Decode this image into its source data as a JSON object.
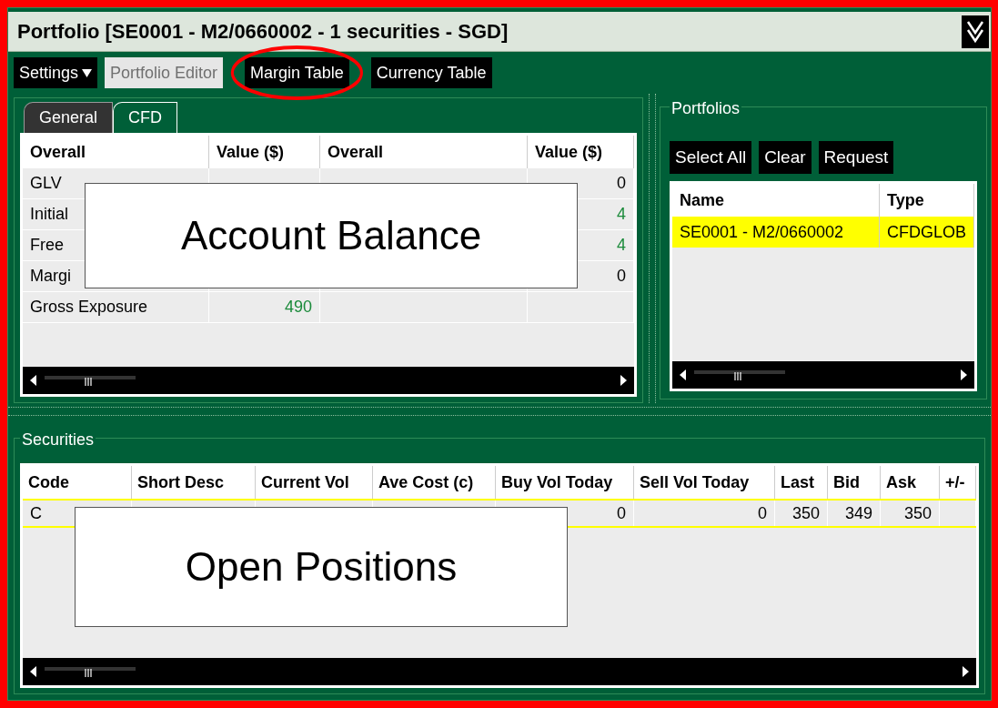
{
  "window": {
    "title": "Portfolio [SE0001 - M2/0660002 - 1 securities - SGD]"
  },
  "toolbar": [
    {
      "label": "Settings",
      "kind": "dropdown",
      "disabled": false,
      "highlighted": false
    },
    {
      "label": "Portfolio Editor",
      "kind": "button",
      "disabled": true,
      "highlighted": false
    },
    {
      "label": "Margin Table",
      "kind": "button",
      "disabled": false,
      "highlighted": true
    },
    {
      "label": "Currency Table",
      "kind": "button",
      "disabled": false,
      "highlighted": false
    }
  ],
  "tabs": [
    {
      "label": "General",
      "selected": false
    },
    {
      "label": "CFD",
      "selected": true
    }
  ],
  "balance_table": {
    "callout": "Account Balance",
    "columns": [
      "Overall",
      "Value ($)",
      "Overall",
      "Value ($)"
    ],
    "rows": [
      [
        {
          "text": "GLV"
        },
        null,
        null,
        {
          "text": "0",
          "color": "#000000"
        }
      ],
      [
        {
          "text": "Initial"
        },
        null,
        null,
        {
          "text": "4",
          "color": "#1a8a3a"
        }
      ],
      [
        {
          "text": "Free"
        },
        null,
        null,
        {
          "text": "4",
          "color": "#1a8a3a"
        }
      ],
      [
        {
          "text": "Margi"
        },
        null,
        null,
        {
          "text": "0",
          "color": "#000000"
        }
      ],
      [
        {
          "text": "Gross Exposure"
        },
        {
          "text": "490",
          "color": "#1a8a3a"
        },
        null,
        null
      ]
    ]
  },
  "portfolios": {
    "title": "Portfolios",
    "buttons": [
      "Select All",
      "Clear",
      "Request"
    ],
    "columns": [
      "Name",
      "Type"
    ],
    "rows": [
      {
        "cells": [
          "SE0001 - M2/0660002",
          "CFDGLOB"
        ],
        "selected": true
      }
    ]
  },
  "securities": {
    "title": "Securities",
    "callout": "Open Positions",
    "columns": [
      "Code",
      "Short Desc",
      "Current Vol",
      "Ave Cost (c)",
      "Buy Vol Today",
      "Sell Vol Today",
      "Last",
      "Bid",
      "Ask",
      "+/-"
    ],
    "rows": [
      {
        "cells": [
          "C",
          null,
          null,
          null,
          "0",
          "0",
          "350",
          "349",
          "350",
          null
        ],
        "selected": true
      }
    ]
  }
}
